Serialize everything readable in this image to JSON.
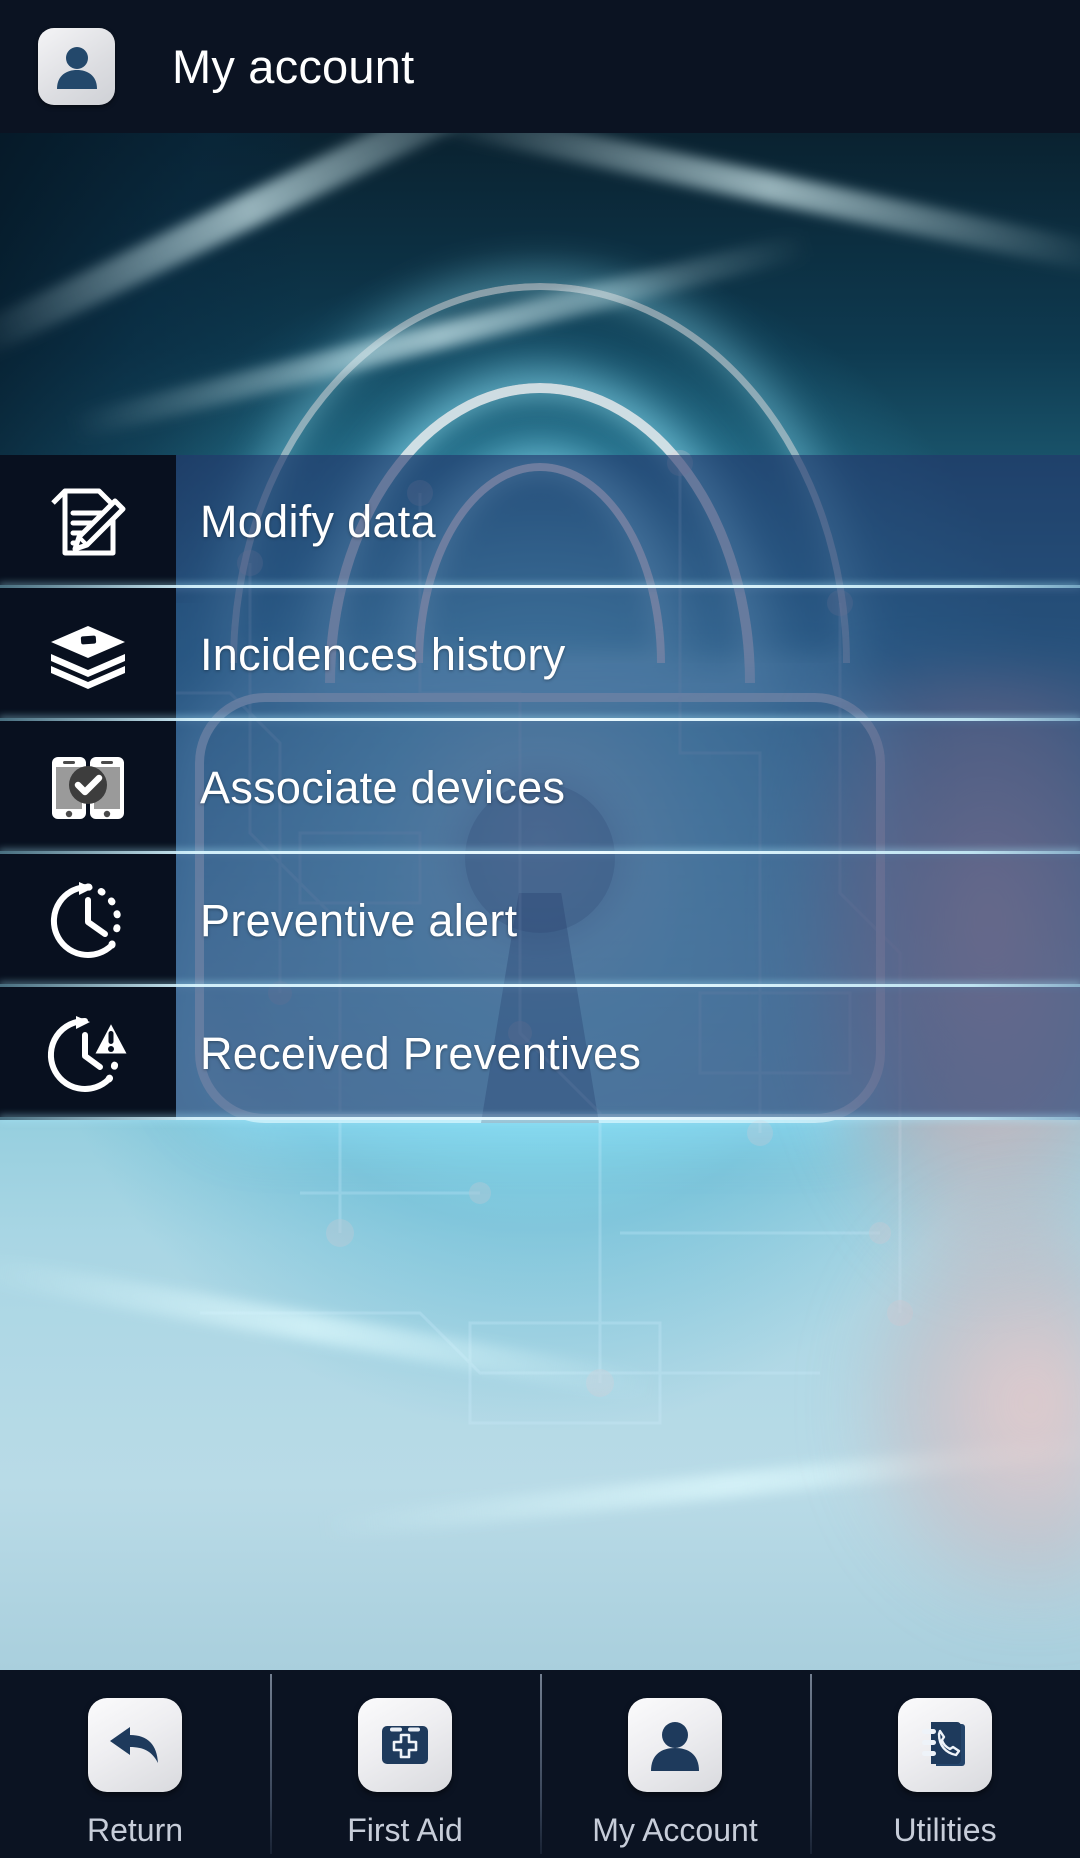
{
  "header": {
    "title": "My account",
    "avatar_icon": "user-avatar-icon",
    "background": "#0b1322"
  },
  "background": {
    "description": "glowing cyan digital padlock with circuit traces",
    "accent": "#8fe6ff"
  },
  "menu": {
    "items": [
      {
        "label": "Modify data",
        "icon": "document-pencil-icon"
      },
      {
        "label": "Incidences history",
        "icon": "stacked-books-icon"
      },
      {
        "label": "Associate devices",
        "icon": "two-phones-check-icon"
      },
      {
        "label": "Preventive alert",
        "icon": "clock-arrow-icon"
      },
      {
        "label": "Received Preventives",
        "icon": "clock-warning-icon"
      }
    ],
    "row_background": "#24376c",
    "icon_cell_background": "#08101f",
    "separator_color": "#d7f5ff"
  },
  "bottom_nav": {
    "items": [
      {
        "label": "Return",
        "icon": "back-arrow-icon"
      },
      {
        "label": "First Aid",
        "icon": "first-aid-kit-icon"
      },
      {
        "label": "My Account",
        "icon": "user-avatar-icon"
      },
      {
        "label": "Utilities",
        "icon": "phone-book-icon"
      }
    ],
    "background": "#0b1322",
    "label_color": "#c7cdd9",
    "glyph_color": "#1e3a5c"
  }
}
